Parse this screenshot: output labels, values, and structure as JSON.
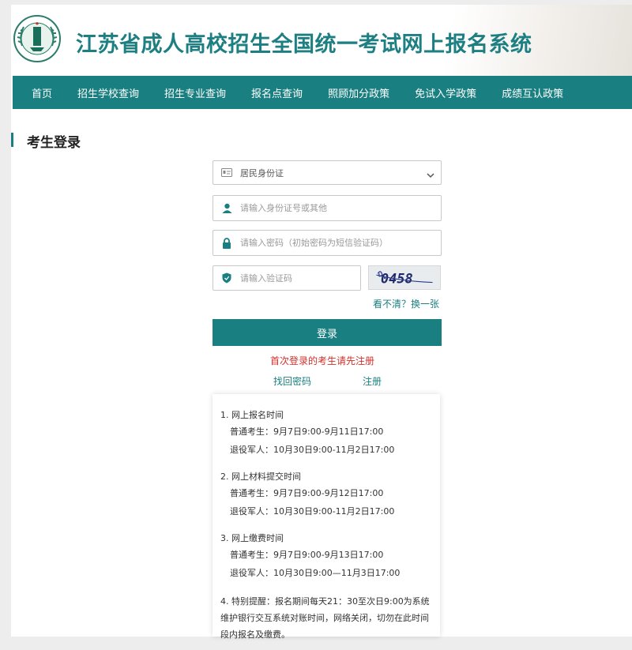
{
  "header": {
    "title": "江苏省成人高校招生全国统一考试网上报名系统"
  },
  "nav": {
    "items": [
      "首页",
      "招生学校查询",
      "招生专业查询",
      "报名点查询",
      "照顾加分政策",
      "免试入学政策",
      "成绩互认政策"
    ]
  },
  "login": {
    "section_title": "考生登录",
    "id_type_value": "居民身份证",
    "id_placeholder": "请输入身份证号或其他",
    "password_placeholder": "请输入密码（初始密码为短信验证码）",
    "captcha_placeholder": "请输入验证码",
    "captcha_text": "0458",
    "refresh_label": "看不清？换一张",
    "login_button": "登录",
    "first_time_notice": "首次登录的考生请先注册",
    "forgot_password": "找回密码",
    "register": "注册"
  },
  "info": {
    "sections": [
      {
        "heading": "1. 网上报名时间",
        "lines": [
          "普通考生：9月7日9:00-9月11日17:00",
          "退役军人：10月30日9:00-11月2日17:00"
        ]
      },
      {
        "heading": "2. 网上材料提交时间",
        "lines": [
          "普通考生：9月7日9:00-9月12日17:00",
          "退役军人：10月30日9:00-11月2日17:00"
        ]
      },
      {
        "heading": "3. 网上缴费时间",
        "lines": [
          "普通考生：9月7日9:00-9月13日17:00",
          "退役军人：10月30日9:00—11月3日17:00"
        ]
      }
    ],
    "tip": "4. 特别提醒：报名期间每天21：30至次日9:00为系统维护银行交互系统对账时间，网络关闭，切勿在此时间段内报名及缴费。"
  },
  "colors": {
    "brand": "#1a7f80",
    "notice": "#d0302b"
  },
  "icons": {
    "id_card": "id-card-icon",
    "user": "user-icon",
    "lock": "lock-icon",
    "shield": "shield-icon",
    "dropdown": "chevron-down-icon",
    "logo": "school-logo"
  }
}
